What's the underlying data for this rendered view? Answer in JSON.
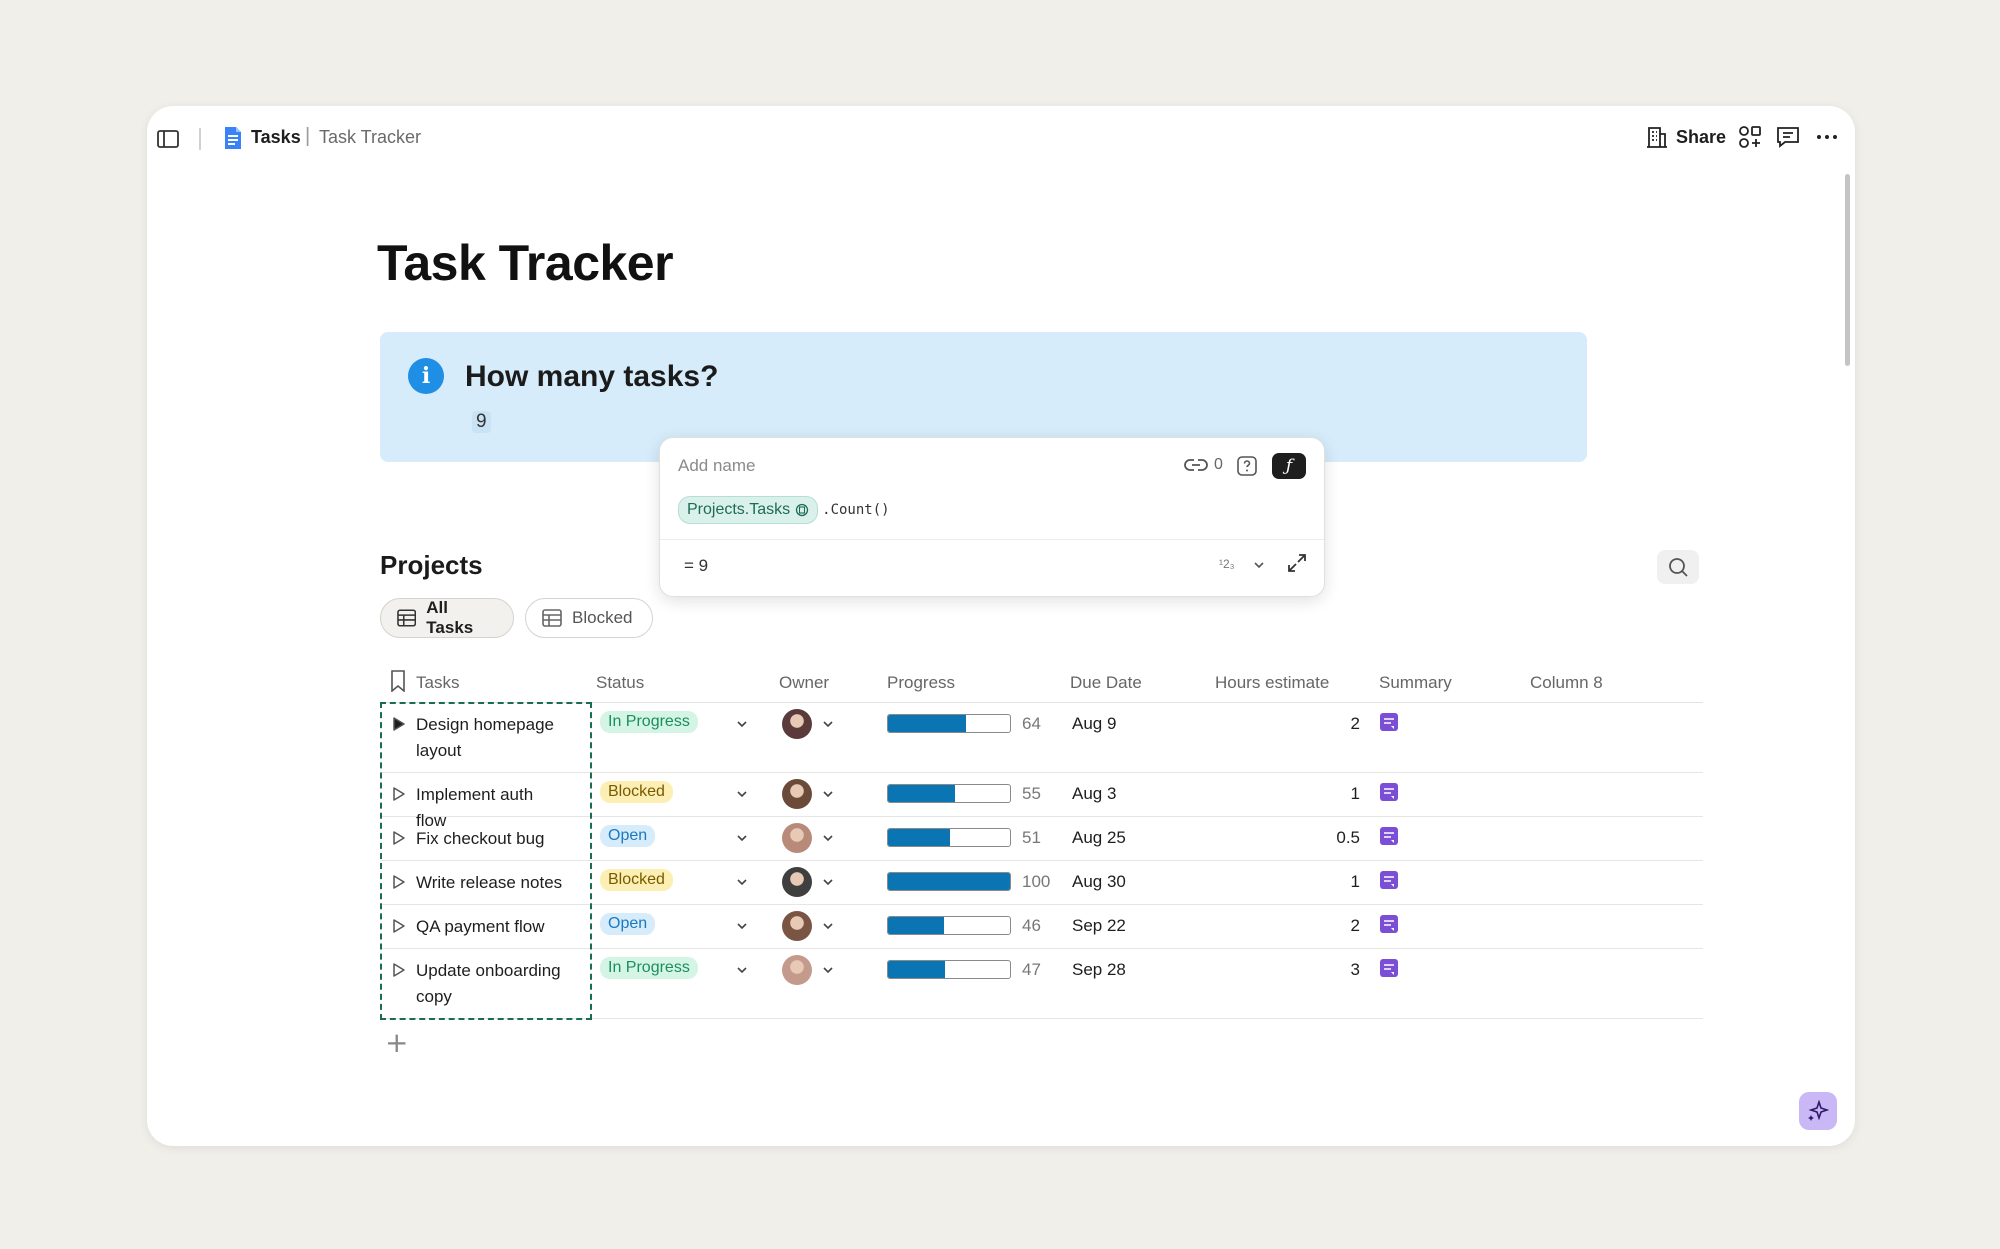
{
  "topbar": {
    "doc_name": "Tasks",
    "separator": "|",
    "page_name": "Task Tracker",
    "share_label": "Share"
  },
  "page": {
    "title": "Task Tracker"
  },
  "callout": {
    "heading": "How many tasks?",
    "value": "9"
  },
  "formula_popup": {
    "name_placeholder": "Add name",
    "link_count": "0",
    "fx_label": "ƒ",
    "pill_label": "Projects.Tasks",
    "code": ".Count()",
    "result": "=  9",
    "type_label": "¹2₃"
  },
  "projects": {
    "title": "Projects",
    "tabs": [
      {
        "label": "All Tasks",
        "active": true
      },
      {
        "label": "Blocked",
        "active": false
      }
    ]
  },
  "table": {
    "columns": [
      "Tasks",
      "Status",
      "Owner",
      "Progress",
      "Due Date",
      "Hours estimate",
      "Summary",
      "Column 8"
    ],
    "rows": [
      {
        "task": "Design homepage layout",
        "status": "In Progress",
        "status_type": "inprogress",
        "progress": 64,
        "due": "Aug 9",
        "hours": "2",
        "expanded": true,
        "avatar_color": "#5a3a3a"
      },
      {
        "task": "Implement auth flow",
        "status": "Blocked",
        "status_type": "blocked",
        "progress": 55,
        "due": "Aug 3",
        "hours": "1",
        "expanded": false,
        "avatar_color": "#6b4a3a"
      },
      {
        "task": "Fix checkout bug",
        "status": "Open",
        "status_type": "open",
        "progress": 51,
        "due": "Aug 25",
        "hours": "0.5",
        "expanded": false,
        "avatar_color": "#b88a7a"
      },
      {
        "task": "Write release notes",
        "status": "Blocked",
        "status_type": "blocked",
        "progress": 100,
        "due": "Aug 30",
        "hours": "1",
        "expanded": false,
        "avatar_color": "#3f3f3f"
      },
      {
        "task": "QA payment flow",
        "status": "Open",
        "status_type": "open",
        "progress": 46,
        "due": "Sep 22",
        "hours": "2",
        "expanded": false,
        "avatar_color": "#7a5544"
      },
      {
        "task": "Update onboarding copy",
        "status": "In Progress",
        "status_type": "inprogress",
        "progress": 47,
        "due": "Sep 28",
        "hours": "3",
        "expanded": false,
        "avatar_color": "#c49a8c"
      }
    ]
  },
  "colors": {
    "callout_bg": "#d6ecfa",
    "progress_fill": "#0b75b3",
    "selection_outline": "#1a6c55",
    "summary_icon": "#7a4fd6",
    "ai_button": "#c9b7f6"
  },
  "icons": [
    "sidebar-toggle-icon",
    "doc-icon",
    "building-icon",
    "apps-icon",
    "comment-icon",
    "more-icon",
    "info-icon",
    "link-icon",
    "help-icon",
    "search-icon",
    "table-icon",
    "bookmark-icon",
    "expand-arrow-icon",
    "chevron-down-icon",
    "summary-icon",
    "plus-icon",
    "ai-sparkle-icon",
    "fullscreen-icon"
  ]
}
